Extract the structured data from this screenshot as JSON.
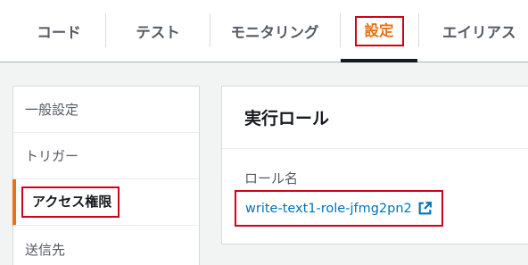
{
  "tabs": [
    {
      "label": "コード"
    },
    {
      "label": "テスト"
    },
    {
      "label": "モニタリング"
    },
    {
      "label": "設定"
    },
    {
      "label": "エイリアス"
    }
  ],
  "active_tab": "設定",
  "sidenav": {
    "items": [
      {
        "label": "一般設定"
      },
      {
        "label": "トリガー"
      },
      {
        "label": "アクセス権限"
      },
      {
        "label": "送信先"
      }
    ],
    "active": "アクセス権限"
  },
  "execution_role": {
    "title": "実行ロール",
    "role_name_label": "ロール名",
    "role_name": "write-text1-role-jfmg2pn2",
    "link_icon": "external-link-icon"
  },
  "colors": {
    "accent_orange": "#ec7211",
    "link_blue": "#0073bb",
    "highlight_red": "#d0021b"
  }
}
